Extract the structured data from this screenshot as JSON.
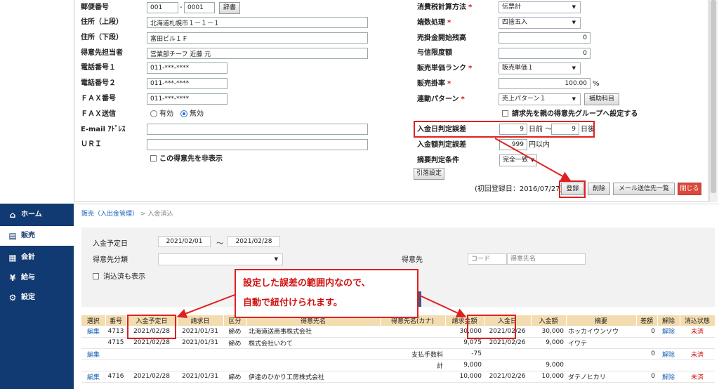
{
  "form": {
    "postal": {
      "label": "郵便番号",
      "v1": "001",
      "v2": "0001",
      "dict": "辞書"
    },
    "addr1": {
      "label": "住所（上段）",
      "value": "北海道札幌市１－１－１"
    },
    "addr2": {
      "label": "住所（下段）",
      "value": "富田ビル１Ｆ"
    },
    "contact": {
      "label": "得意先担当者",
      "value": "営業部チーフ 近藤 元"
    },
    "tel1": {
      "label": "電話番号１",
      "value": "011-***-****"
    },
    "tel2": {
      "label": "電話番号２",
      "value": "011-***-****"
    },
    "fax": {
      "label": "ＦＡＸ番号",
      "value": "011-***-****"
    },
    "faxsend": {
      "label": "ＦＡＸ送信",
      "opt1": "有効",
      "opt2": "無効"
    },
    "email": {
      "label": "E-mail ｱﾄﾞﾚｽ",
      "value": ""
    },
    "uri": {
      "label": "ＵＲＩ",
      "value": ""
    },
    "hide": {
      "label": "この得意先を非表示"
    },
    "tax": {
      "label": "消費税計算方法",
      "value": "伝票計"
    },
    "rounding": {
      "label": "端数処理",
      "value": "四捨五入"
    },
    "opening": {
      "label": "売掛金開始残高",
      "value": "0"
    },
    "credit": {
      "label": "与信限度額",
      "value": "0"
    },
    "rank": {
      "label": "販売単価ランク",
      "value": "販売単価１"
    },
    "rate": {
      "label": "販売掛率",
      "value": "100.00",
      "unit": "%"
    },
    "pattern": {
      "label": "連動パターン",
      "value": "売上パターン１",
      "btn": "補助科目"
    },
    "group": {
      "label": "請求先を親の得意先グループへ設定する"
    },
    "datetol": {
      "label": "入金日判定誤差",
      "before": "9",
      "before_unit": "日前",
      "tilde": "～",
      "after": "9",
      "after_unit": "日後"
    },
    "amttol": {
      "label": "入金額判定誤差",
      "value": "999",
      "unit": "円以内"
    },
    "summary": {
      "label": "摘要判定条件",
      "value": "完全一致"
    },
    "inherit": "引落設定",
    "created": "(初回登録日：2016/07/27)",
    "buttons": {
      "register": "登録",
      "delete": "削除",
      "mail": "メール送信先一覧",
      "close": "閉じる"
    }
  },
  "sidebar": {
    "items": [
      {
        "label": "ホーム",
        "icon": "home-icon"
      },
      {
        "label": "販売",
        "icon": "clipboard-icon"
      },
      {
        "label": "会計",
        "icon": "calculator-icon"
      },
      {
        "label": "給与",
        "icon": "moneybag-icon"
      },
      {
        "label": "設定",
        "icon": "gear-icon"
      }
    ]
  },
  "breadcrumb": {
    "link": "販売（入出金管理）",
    "sep": ">",
    "current": "入金消込"
  },
  "filter": {
    "date_label": "入金予定日",
    "from": "2021/02/01",
    "tilde": "～",
    "to": "2021/02/28",
    "category_label": "得意先分類",
    "customer_label": "得意先",
    "code_placeholder": "コード",
    "name_placeholder": "得意先名",
    "show_done": "消込済も表示"
  },
  "callout": {
    "line1": "設定した誤差の範囲内なので、",
    "line2": "自動で紐付けられます。"
  },
  "table": {
    "headers": [
      "選択",
      "番号",
      "入金予定日",
      "請求日",
      "区分",
      "得意先名",
      "得意先名(カナ)",
      "請求金額",
      "入金日",
      "入金額",
      "摘要",
      "差額",
      "解除",
      "消込状態"
    ],
    "rows": [
      {
        "sel": "編集",
        "no": "4713",
        "sched": "2021/02/28",
        "bill": "2021/01/31",
        "kbn": "締め",
        "name": "北海道送商事株式会社",
        "kana": "",
        "amt": "30,000",
        "pdate": "2021/02/26",
        "pamt": "30,000",
        "memo": "ホッカイウンソウ",
        "diff": "0",
        "undo": "解除",
        "status": "未済"
      },
      {
        "sel": "",
        "no": "4715",
        "sched": "2021/02/28",
        "bill": "2021/01/31",
        "kbn": "締め",
        "name": "株式会社いわて",
        "kana": "",
        "amt": "9,075",
        "pdate": "2021/02/26",
        "pamt": "9,000",
        "memo": "イワテ",
        "diff": "",
        "undo": "",
        "status": ""
      },
      {
        "sel": "編集",
        "no": "",
        "sched": "",
        "bill": "",
        "kbn": "",
        "name": "",
        "kana": "支払手数料",
        "amt": "-75",
        "pdate": "",
        "pamt": "",
        "memo": "",
        "diff": "0",
        "undo": "解除",
        "status": "未済"
      },
      {
        "sel": "",
        "no": "",
        "sched": "",
        "bill": "",
        "kbn": "",
        "name": "",
        "kana": "計",
        "amt": "9,000",
        "pdate": "",
        "pamt": "9,000",
        "memo": "",
        "diff": "",
        "undo": "",
        "status": ""
      },
      {
        "sel": "編集",
        "no": "4716",
        "sched": "2021/02/28",
        "bill": "2021/01/31",
        "kbn": "締め",
        "name": "伊達のひかり工房株式会社",
        "kana": "",
        "amt": "10,000",
        "pdate": "2021/02/26",
        "pamt": "10,000",
        "memo": "ダテノヒカリ",
        "diff": "0",
        "undo": "解除",
        "status": "未済"
      }
    ]
  }
}
